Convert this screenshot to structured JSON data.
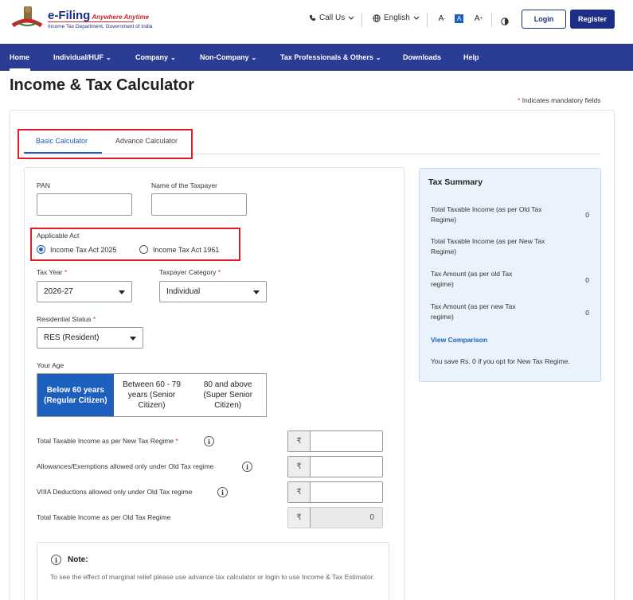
{
  "header": {
    "logo_title": "e-Filing",
    "logo_tagline": "Anywhere Anytime",
    "logo_subtitle": "Income Tax Department, Government of India",
    "call_us": "Call Us",
    "language": "English",
    "font_small": "A",
    "font_normal": "A",
    "font_large": "A",
    "login": "Login",
    "register": "Register"
  },
  "nav": {
    "items": [
      "Home",
      "Individual/HUF",
      "Company",
      "Non-Company",
      "Tax Professionals & Others",
      "Downloads",
      "Help"
    ]
  },
  "page": {
    "title": "Income & Tax Calculator",
    "mandatory_note": "Indicates mandatory fields",
    "mandatory_star": "*"
  },
  "tabs": [
    "Basic Calculator",
    "Advance Calculator"
  ],
  "form": {
    "pan_label": "PAN",
    "pan_value": "",
    "name_label": "Name of the Taxpayer",
    "name_value": "",
    "act_label": "Applicable Act",
    "act_options": [
      "Income Tax Act 2025",
      "Income Tax Act 1961"
    ],
    "act_selected": "Income Tax Act 2025",
    "tax_year_label": "Tax Year",
    "tax_year_value": "2026-27",
    "category_label": "Taxpayer Category",
    "category_value": "Individual",
    "residential_label": "Residential Status",
    "residential_value": "RES (Resident)",
    "age_label": "Your Age",
    "age_options": [
      "Below 60 years (Regular Citizen)",
      "Between 60 - 79 years (Senior Citizen)",
      "80 and above (Super Senior Citizen)"
    ],
    "age_selected": "Below 60 years (Regular Citizen)",
    "income_rows": [
      {
        "label": "Total Taxable Income as per New Tax Regime",
        "required": true,
        "info": true,
        "value": "",
        "readonly": false
      },
      {
        "label": "Allowances/Exemptions allowed only under Old Tax regime",
        "required": false,
        "info": true,
        "value": "",
        "readonly": false
      },
      {
        "label": "VIIIA Deductions allowed only under Old Tax regime",
        "required": false,
        "info": true,
        "value": "",
        "readonly": false
      },
      {
        "label": "Total Taxable Income as per Old Tax Regime",
        "required": false,
        "info": false,
        "value": "0",
        "readonly": true
      }
    ],
    "currency_symbol": "₹",
    "note_title": "Note:",
    "note_text": "To see the effect of marginal relief please use advance tax calculator or login to use Income & Tax Estimator."
  },
  "summary": {
    "title": "Tax Summary",
    "rows": [
      {
        "label": "Total Taxable Income (as per Old Tax Regime)",
        "value": "0"
      },
      {
        "label": "Total Taxable Income (as per New Tax Regime)",
        "value": ""
      },
      {
        "label": "Tax Amount (as per old Tax regime)",
        "value": "0"
      },
      {
        "label": "Tax Amount (as per new Tax regime)",
        "value": "0"
      }
    ],
    "view_comparison": "View Comparison",
    "savings_text": "You save Rs. 0 if you opt for New Tax Regime."
  },
  "colors": {
    "primary": "#1c2f84",
    "nav_bg": "#2a3c94",
    "accent_blue": "#1c5fbf",
    "highlight_red": "#e11b22",
    "summary_bg": "#eaf2fc"
  }
}
